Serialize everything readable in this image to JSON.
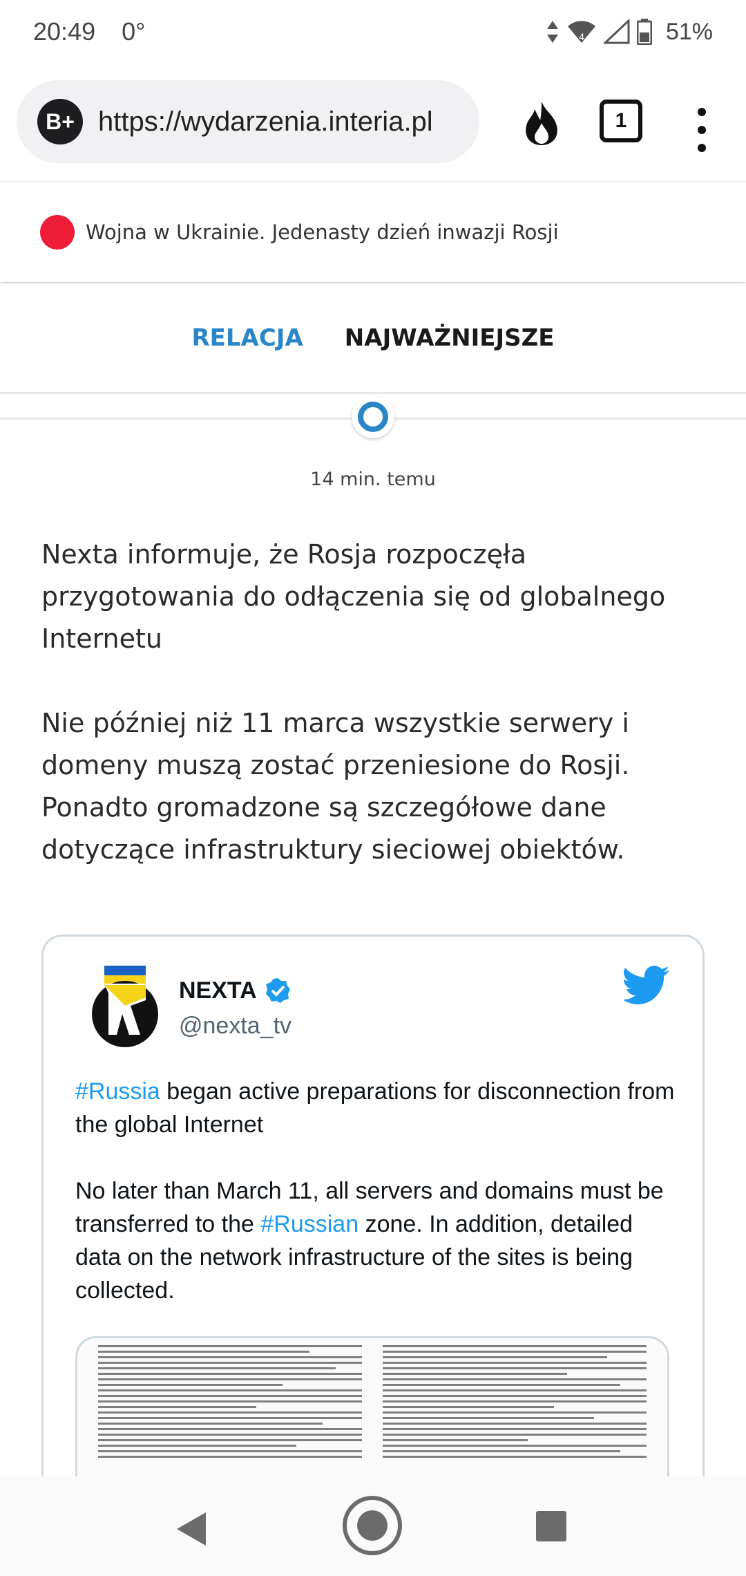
{
  "status_bar": {
    "time": "20:49",
    "temperature": "0°",
    "battery": "51%",
    "icons": [
      "data-arrows-icon",
      "wifi-icon",
      "signal-icon",
      "battery-icon"
    ]
  },
  "browser": {
    "site_badge": "B+",
    "url": "https://wydarzenia.interia.pl",
    "tab_count": "1",
    "icons": [
      "fire-icon",
      "tabs-icon",
      "overflow-menu-icon"
    ]
  },
  "banner": {
    "text": "Wojna w Ukrainie. Jedenasty dzień inwazji Rosji",
    "live_color": "#ee1c36"
  },
  "tabs": [
    {
      "label": "RELACJA",
      "active": true
    },
    {
      "label": "NAJWAŻNIEJSZE",
      "active": false
    }
  ],
  "post": {
    "timestamp": "14 min. temu",
    "paragraphs": [
      "Nexta informuje, że Rosja rozpoczęła przygotowania do odłączenia się od globalnego Internetu",
      "Nie później niż 11 marca wszystkie serwery i domeny muszą zostać przeniesione do Rosji. Ponadto gromadzone są szczegółowe dane dotyczące infrastruktury sieciowej obiektów."
    ]
  },
  "tweet": {
    "name": "NEXTA",
    "handle": "@nexta_tv",
    "p1_hashtag": "#Russia",
    "p1_text": " began active preparations for disconnection from the global Internet",
    "p2_before": "No later than March 11, all servers and domains must be transferred to the ",
    "p2_hashtag": "#Russian",
    "p2_after": " zone. In addition, detailed data on the network infrastructure of the sites is being collected.",
    "accent_color": "#1d9bf0"
  },
  "accent_color": "#2b86c8"
}
